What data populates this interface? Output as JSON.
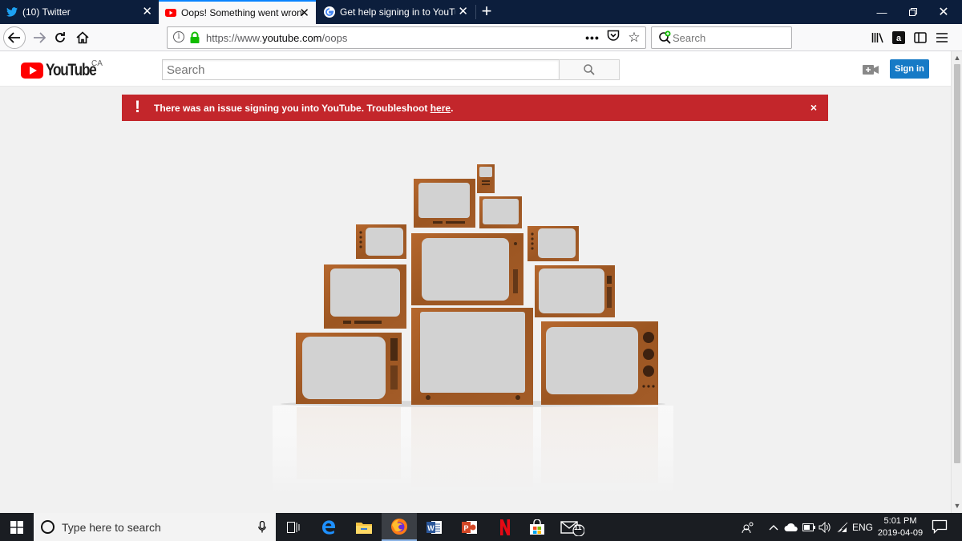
{
  "browser": {
    "tabs": [
      {
        "title": "(10) Twitter",
        "icon": "twitter-icon",
        "active": false
      },
      {
        "title": "Oops! Something went wrong",
        "icon": "youtube-icon",
        "active": true
      },
      {
        "title": "Get help signing in to YouTube",
        "icon": "google-icon",
        "active": false
      }
    ],
    "url": {
      "prefix": "https://www.",
      "domain": "youtube.com",
      "path": "/oops"
    },
    "search_placeholder": "Search"
  },
  "youtube": {
    "logo_text": "YouTube",
    "country": "CA",
    "search_placeholder": "Search",
    "sign_in_label": "Sign in",
    "alert": {
      "icon": "!",
      "message": "There was an issue signing you into YouTube. Troubleshoot ",
      "link_text": "here",
      "after_link": ".",
      "close": "×",
      "color": "#c3262b"
    }
  },
  "taskbar": {
    "search_placeholder": "Type here to search",
    "apps": [
      "task-view",
      "edge",
      "file-explorer",
      "firefox",
      "word",
      "powerpoint",
      "netflix",
      "store",
      "mail"
    ],
    "mail_badge": "11",
    "language": "ENG",
    "time": "5:01 PM",
    "date": "2019-04-09"
  },
  "colors": {
    "tabstrip": "#0c1e3c",
    "accent": "#0a84ff",
    "yt_red": "#ff0000",
    "signin_blue": "#167ac6"
  }
}
